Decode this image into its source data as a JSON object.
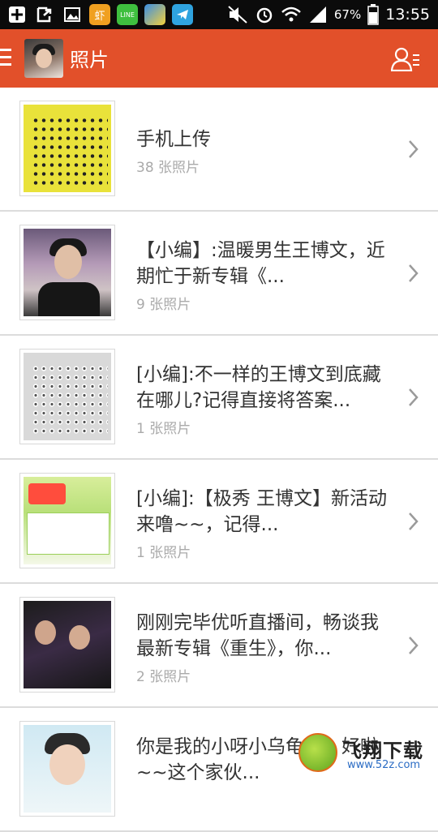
{
  "status_bar": {
    "battery_percent": "67%",
    "time": "13:55",
    "icons_left": [
      "add-icon",
      "share-icon",
      "gallery-icon",
      "xia-app-icon",
      "line-app-icon",
      "game-app-icon",
      "telegram-icon"
    ],
    "icons_right": [
      "mute-icon",
      "alarm-icon",
      "wifi-icon",
      "signal-icon",
      "battery-icon"
    ]
  },
  "app_bar": {
    "title": "照片",
    "accent_color": "#e2502a"
  },
  "albums": [
    {
      "title": "手机上传",
      "count": "38 张照片",
      "thumb": "grid-yellow"
    },
    {
      "title": "【小编】:温暖男生王博文，近期忙于新专辑《...",
      "count": "9 张照片",
      "thumb": "portrait"
    },
    {
      "title": "[小编]:不一样的王博文到底藏在哪儿?记得直接将答案...",
      "count": "1 张照片",
      "thumb": "grid-gray"
    },
    {
      "title": "[小编]:【极秀 王博文】新活动来噜~~，记得...",
      "count": "1 张照片",
      "thumb": "poster"
    },
    {
      "title": "刚刚完毕优听直播间，畅谈我最新专辑《重生》，你...",
      "count": "2 张照片",
      "thumb": "duo"
    },
    {
      "title": "你是我的小呀小乌龟。。。好啦~~这个家伙...",
      "count": "",
      "thumb": "boy"
    }
  ],
  "watermark": {
    "brand": "飞翔下载",
    "url": "www.52z.com"
  }
}
